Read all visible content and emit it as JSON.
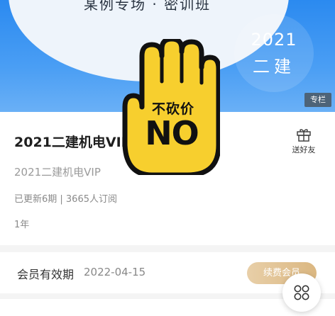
{
  "banner": {
    "caption": "某例专场 · 密训班",
    "year": "2021",
    "category": "二建",
    "column_tag": "专栏"
  },
  "course": {
    "title": "2021二建机电VIP",
    "gift_label": "送好友",
    "subtitle": "2021二建机电VIP",
    "stats": "已更新6期 | 3665人订阅",
    "duration": "1年"
  },
  "membership": {
    "label": "会员有效期",
    "expiry": "2022-04-15",
    "renew_label": "续费会员"
  },
  "sticker": {
    "top_text": "不砍价",
    "big_text": "NO"
  },
  "colors": {
    "banner_blue": "#2b8af0",
    "sticker_yellow": "#f7cf2e",
    "renew_gold": "#dbb781"
  },
  "icons": [
    "gift-icon",
    "grid-menu-icon",
    "stop-hand-icon"
  ]
}
